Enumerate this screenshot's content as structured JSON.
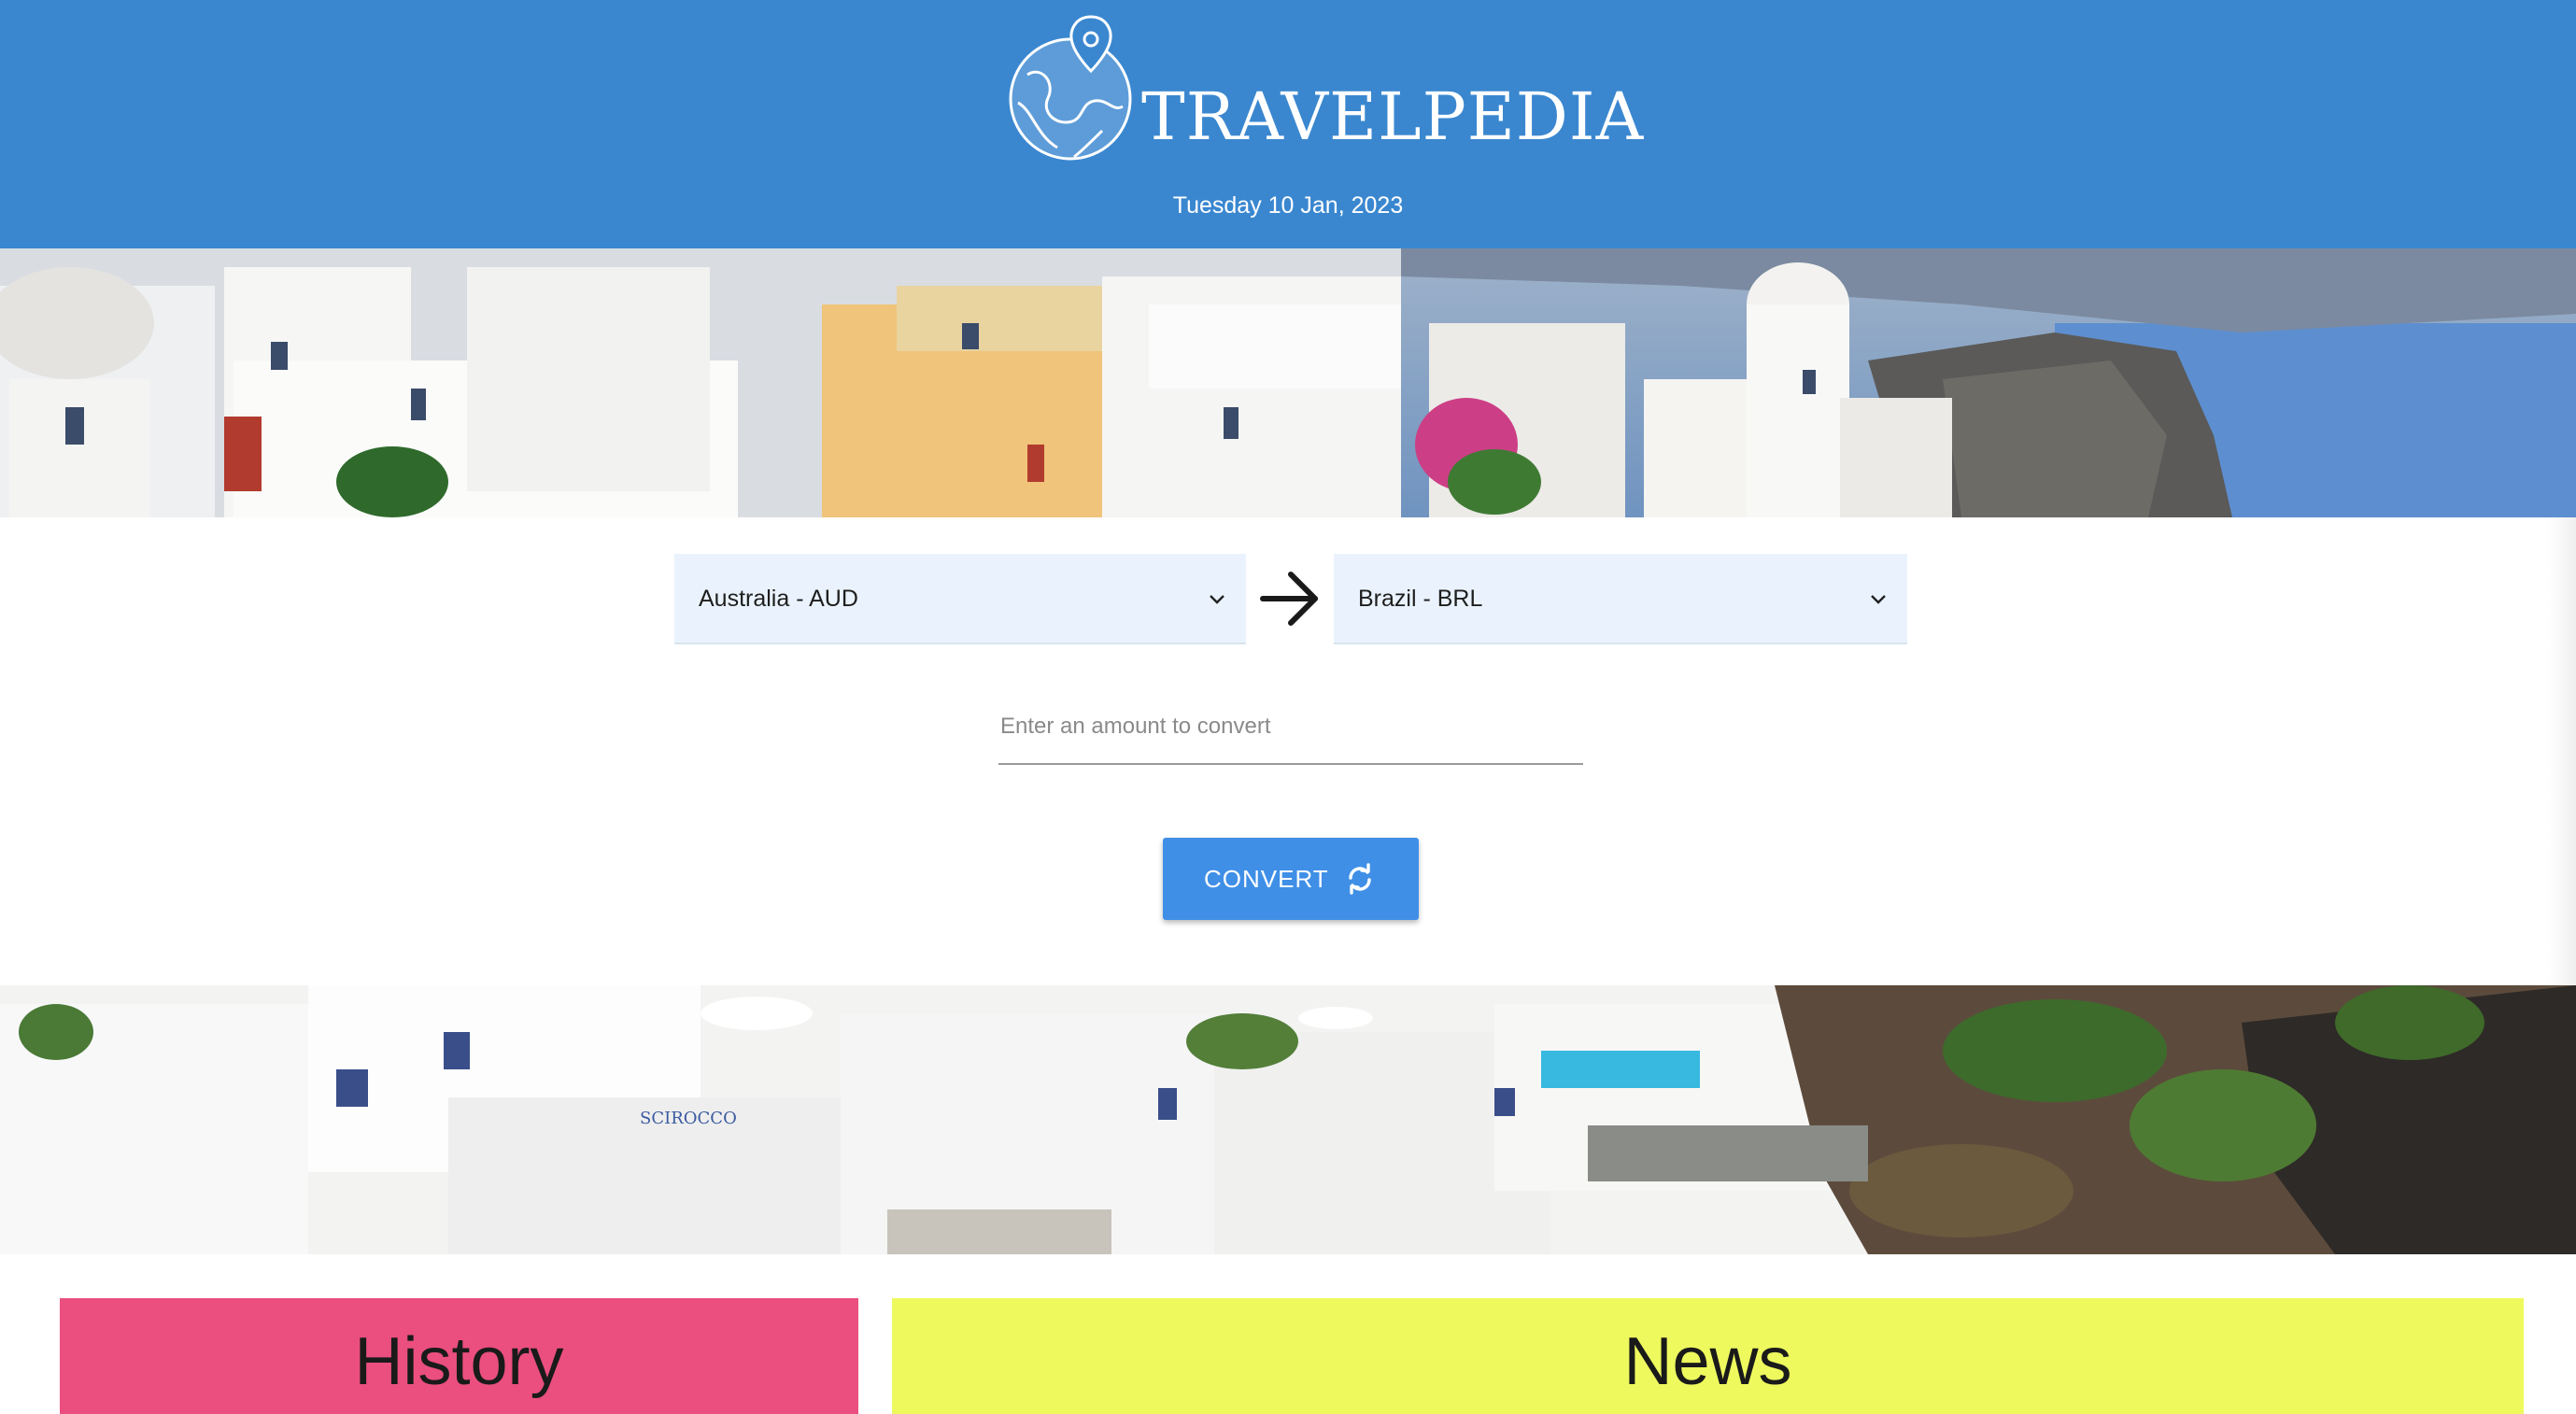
{
  "header": {
    "brand": "TRAVELPEDIA",
    "logo_icon": "globe-location-pin-icon",
    "date": "Tuesday 10 Jan, 2023",
    "background": "#3a87d0"
  },
  "converter": {
    "from_currency": "Australia - AUD",
    "to_currency": "Brazil - BRL",
    "direction_icon": "arrow-right-icon",
    "amount": {
      "value": "",
      "placeholder": "Enter an amount to convert"
    },
    "convert_button": {
      "label": "CONVERT",
      "icon": "refresh-icon",
      "color": "#3f8fe7"
    }
  },
  "sections": [
    {
      "title": "History",
      "color": "#ea4f7f"
    },
    {
      "title": "News",
      "color": "#eef95e"
    }
  ]
}
